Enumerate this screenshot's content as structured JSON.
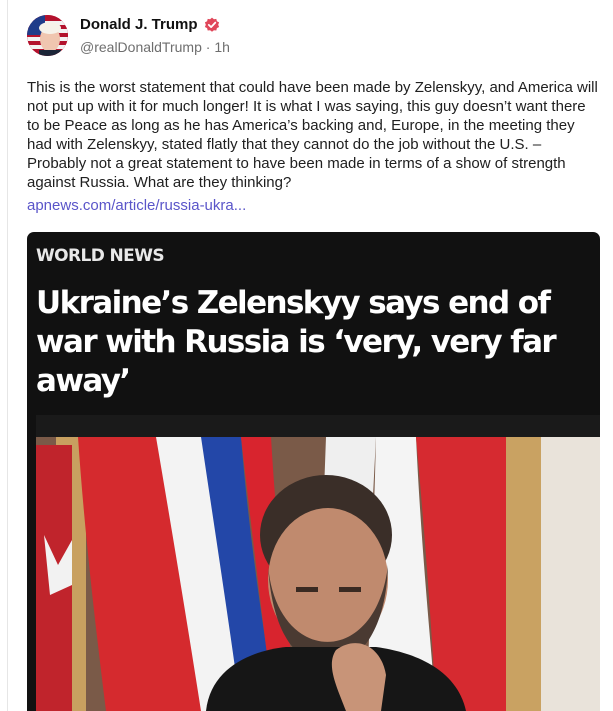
{
  "post": {
    "author_name": "Donald J. Trump",
    "handle": "@realDonaldTrump",
    "separator": "·",
    "time": "1h",
    "body": "This is the worst statement that could have been made by Zelenskyy, and America will not put up with it for much longer! It is what I was saying, this guy doesn’t want there to be Peace as long as he has America’s backing and, Europe, in the meeting they had with Zelenskyy, stated flatly that they cannot do the job without the U.S. – Probably not a great statement to have been made in terms of a show of strength against Russia. What are they thinking?",
    "link_text": "apnews.com/article/russia-ukra..."
  },
  "card": {
    "category": "WORLD NEWS",
    "headline": "Ukraine’s Zelenskyy says end of war with Russia is ‘very, very far away’"
  },
  "icons": {
    "avatar": "avatar-flag-portrait",
    "verified": "verified-badge-icon"
  },
  "colors": {
    "link": "#5a55c9",
    "verified": "#e0475a",
    "card_background": "#111111",
    "handle": "#6e6e6e"
  }
}
